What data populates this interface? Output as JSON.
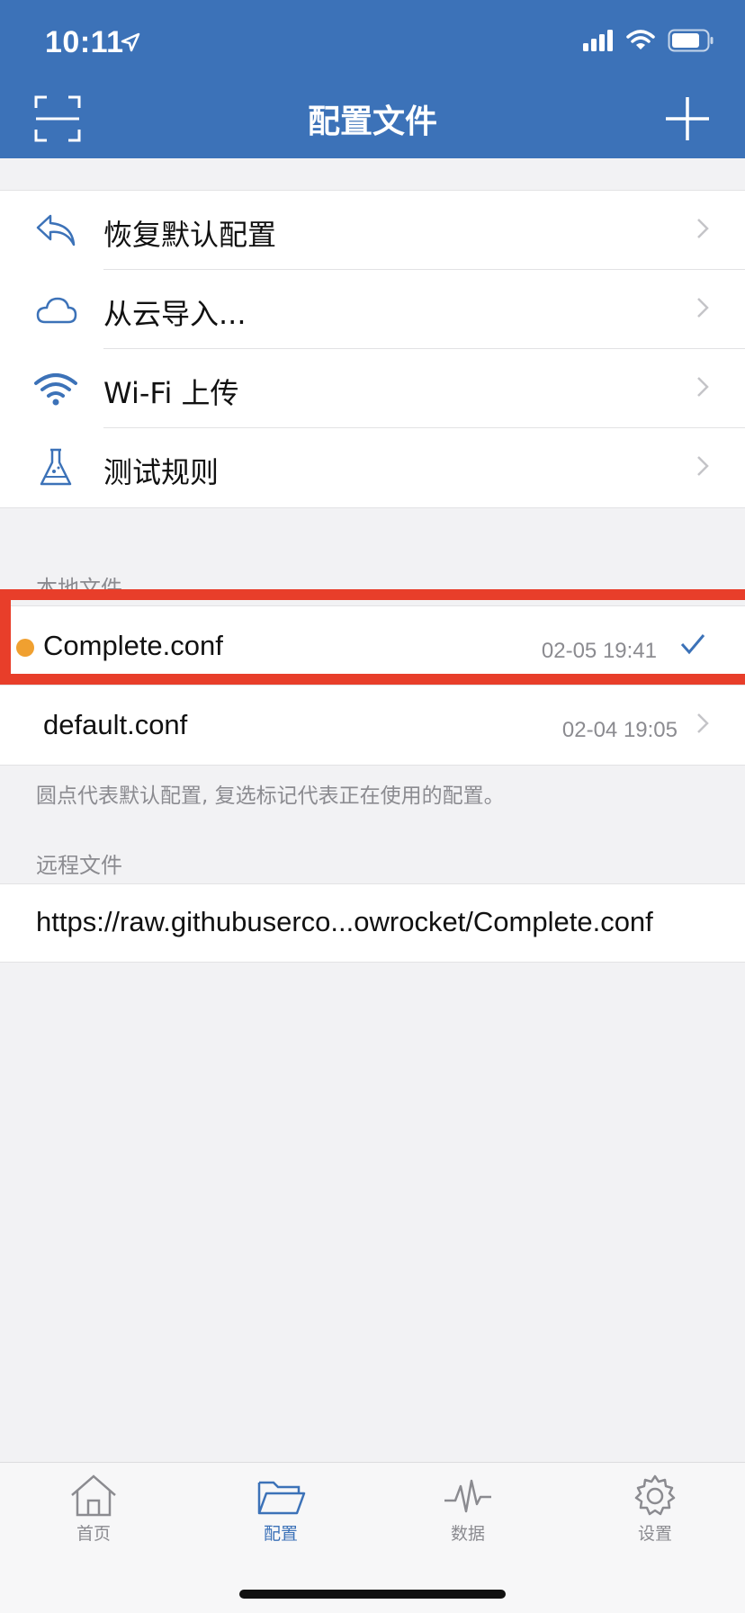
{
  "status_bar": {
    "time": "10:11"
  },
  "nav": {
    "title": "配置文件"
  },
  "menu": [
    {
      "label": "恢复默认配置",
      "icon": "undo-icon"
    },
    {
      "label": "从云导入...",
      "icon": "cloud-icon"
    },
    {
      "label": "Wi-Fi 上传",
      "icon": "wifi-icon"
    },
    {
      "label": "测试规则",
      "icon": "flask-icon"
    }
  ],
  "local_section": {
    "title": "本地文件",
    "files": [
      {
        "name": "Complete.conf",
        "time": "02-05 19:41",
        "default": true,
        "selected": true
      },
      {
        "name": "default.conf",
        "time": "02-04 19:05",
        "default": false,
        "selected": false
      }
    ],
    "note": "圆点代表默认配置, 复选标记代表正在使用的配置。"
  },
  "remote_section": {
    "title": "远程文件",
    "url": "https://raw.githubuserco...owrocket/Complete.conf"
  },
  "tabs": [
    {
      "label": "首页",
      "icon": "home-icon",
      "active": false
    },
    {
      "label": "配置",
      "icon": "folder-icon",
      "active": true
    },
    {
      "label": "数据",
      "icon": "pulse-icon",
      "active": false
    },
    {
      "label": "设置",
      "icon": "gear-icon",
      "active": false
    }
  ],
  "colors": {
    "accent": "#3c72b8",
    "highlight": "#e83e2a",
    "default_dot": "#f0a030"
  }
}
